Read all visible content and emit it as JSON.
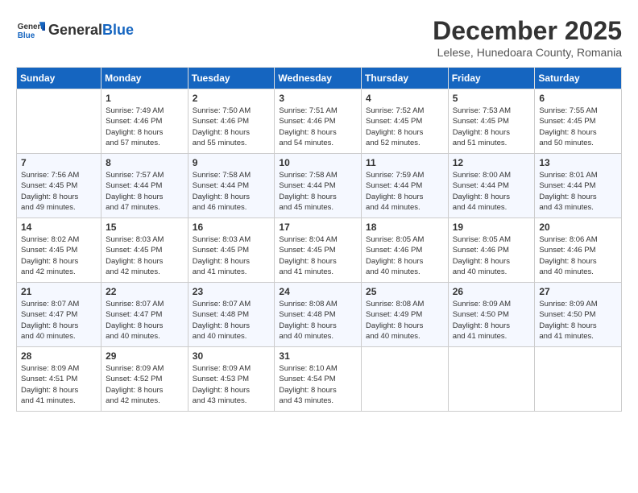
{
  "header": {
    "logo_text_general": "General",
    "logo_text_blue": "Blue",
    "month_title": "December 2025",
    "location": "Lelese, Hunedoara County, Romania"
  },
  "weekdays": [
    "Sunday",
    "Monday",
    "Tuesday",
    "Wednesday",
    "Thursday",
    "Friday",
    "Saturday"
  ],
  "weeks": [
    [
      {
        "day": "",
        "info": ""
      },
      {
        "day": "1",
        "info": "Sunrise: 7:49 AM\nSunset: 4:46 PM\nDaylight: 8 hours\nand 57 minutes."
      },
      {
        "day": "2",
        "info": "Sunrise: 7:50 AM\nSunset: 4:46 PM\nDaylight: 8 hours\nand 55 minutes."
      },
      {
        "day": "3",
        "info": "Sunrise: 7:51 AM\nSunset: 4:46 PM\nDaylight: 8 hours\nand 54 minutes."
      },
      {
        "day": "4",
        "info": "Sunrise: 7:52 AM\nSunset: 4:45 PM\nDaylight: 8 hours\nand 52 minutes."
      },
      {
        "day": "5",
        "info": "Sunrise: 7:53 AM\nSunset: 4:45 PM\nDaylight: 8 hours\nand 51 minutes."
      },
      {
        "day": "6",
        "info": "Sunrise: 7:55 AM\nSunset: 4:45 PM\nDaylight: 8 hours\nand 50 minutes."
      }
    ],
    [
      {
        "day": "7",
        "info": "Sunrise: 7:56 AM\nSunset: 4:45 PM\nDaylight: 8 hours\nand 49 minutes."
      },
      {
        "day": "8",
        "info": "Sunrise: 7:57 AM\nSunset: 4:44 PM\nDaylight: 8 hours\nand 47 minutes."
      },
      {
        "day": "9",
        "info": "Sunrise: 7:58 AM\nSunset: 4:44 PM\nDaylight: 8 hours\nand 46 minutes."
      },
      {
        "day": "10",
        "info": "Sunrise: 7:58 AM\nSunset: 4:44 PM\nDaylight: 8 hours\nand 45 minutes."
      },
      {
        "day": "11",
        "info": "Sunrise: 7:59 AM\nSunset: 4:44 PM\nDaylight: 8 hours\nand 44 minutes."
      },
      {
        "day": "12",
        "info": "Sunrise: 8:00 AM\nSunset: 4:44 PM\nDaylight: 8 hours\nand 44 minutes."
      },
      {
        "day": "13",
        "info": "Sunrise: 8:01 AM\nSunset: 4:44 PM\nDaylight: 8 hours\nand 43 minutes."
      }
    ],
    [
      {
        "day": "14",
        "info": "Sunrise: 8:02 AM\nSunset: 4:45 PM\nDaylight: 8 hours\nand 42 minutes."
      },
      {
        "day": "15",
        "info": "Sunrise: 8:03 AM\nSunset: 4:45 PM\nDaylight: 8 hours\nand 42 minutes."
      },
      {
        "day": "16",
        "info": "Sunrise: 8:03 AM\nSunset: 4:45 PM\nDaylight: 8 hours\nand 41 minutes."
      },
      {
        "day": "17",
        "info": "Sunrise: 8:04 AM\nSunset: 4:45 PM\nDaylight: 8 hours\nand 41 minutes."
      },
      {
        "day": "18",
        "info": "Sunrise: 8:05 AM\nSunset: 4:46 PM\nDaylight: 8 hours\nand 40 minutes."
      },
      {
        "day": "19",
        "info": "Sunrise: 8:05 AM\nSunset: 4:46 PM\nDaylight: 8 hours\nand 40 minutes."
      },
      {
        "day": "20",
        "info": "Sunrise: 8:06 AM\nSunset: 4:46 PM\nDaylight: 8 hours\nand 40 minutes."
      }
    ],
    [
      {
        "day": "21",
        "info": "Sunrise: 8:07 AM\nSunset: 4:47 PM\nDaylight: 8 hours\nand 40 minutes."
      },
      {
        "day": "22",
        "info": "Sunrise: 8:07 AM\nSunset: 4:47 PM\nDaylight: 8 hours\nand 40 minutes."
      },
      {
        "day": "23",
        "info": "Sunrise: 8:07 AM\nSunset: 4:48 PM\nDaylight: 8 hours\nand 40 minutes."
      },
      {
        "day": "24",
        "info": "Sunrise: 8:08 AM\nSunset: 4:48 PM\nDaylight: 8 hours\nand 40 minutes."
      },
      {
        "day": "25",
        "info": "Sunrise: 8:08 AM\nSunset: 4:49 PM\nDaylight: 8 hours\nand 40 minutes."
      },
      {
        "day": "26",
        "info": "Sunrise: 8:09 AM\nSunset: 4:50 PM\nDaylight: 8 hours\nand 41 minutes."
      },
      {
        "day": "27",
        "info": "Sunrise: 8:09 AM\nSunset: 4:50 PM\nDaylight: 8 hours\nand 41 minutes."
      }
    ],
    [
      {
        "day": "28",
        "info": "Sunrise: 8:09 AM\nSunset: 4:51 PM\nDaylight: 8 hours\nand 41 minutes."
      },
      {
        "day": "29",
        "info": "Sunrise: 8:09 AM\nSunset: 4:52 PM\nDaylight: 8 hours\nand 42 minutes."
      },
      {
        "day": "30",
        "info": "Sunrise: 8:09 AM\nSunset: 4:53 PM\nDaylight: 8 hours\nand 43 minutes."
      },
      {
        "day": "31",
        "info": "Sunrise: 8:10 AM\nSunset: 4:54 PM\nDaylight: 8 hours\nand 43 minutes."
      },
      {
        "day": "",
        "info": ""
      },
      {
        "day": "",
        "info": ""
      },
      {
        "day": "",
        "info": ""
      }
    ]
  ]
}
